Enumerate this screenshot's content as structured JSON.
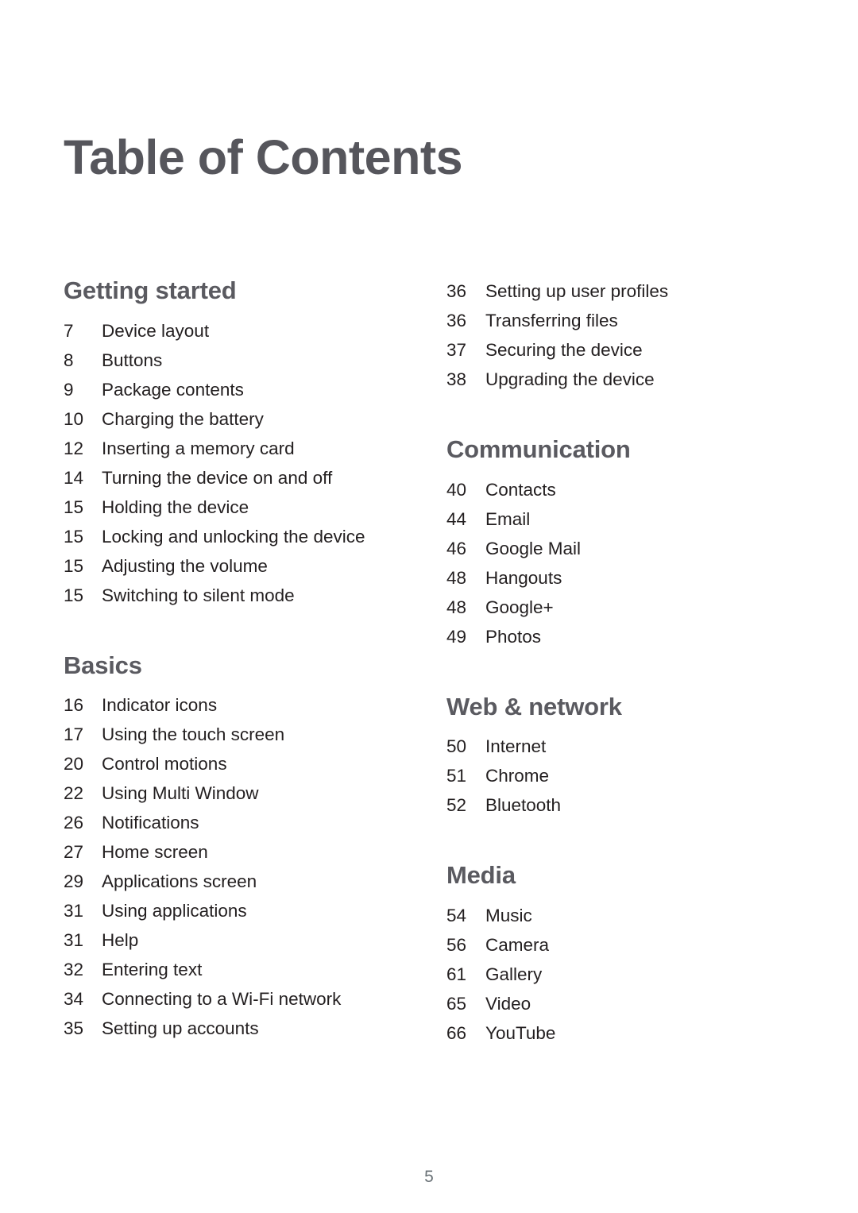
{
  "document": {
    "title": "Table of Contents",
    "folio": "5",
    "colors": {
      "heading": "#5a5a60",
      "title": "#56565c",
      "body": "#231f20",
      "folio": "#6a7277",
      "background": "#ffffff"
    }
  },
  "columns": {
    "left": [
      {
        "heading": "Getting started",
        "heading_visible": true,
        "entries": [
          {
            "page": "7",
            "label": "Device layout"
          },
          {
            "page": "8",
            "label": "Buttons"
          },
          {
            "page": "9",
            "label": "Package contents"
          },
          {
            "page": "10",
            "label": "Charging the battery"
          },
          {
            "page": "12",
            "label": "Inserting a memory card"
          },
          {
            "page": "14",
            "label": "Turning the device on and off"
          },
          {
            "page": "15",
            "label": "Holding the device"
          },
          {
            "page": "15",
            "label": "Locking and unlocking the device"
          },
          {
            "page": "15",
            "label": "Adjusting the volume"
          },
          {
            "page": "15",
            "label": "Switching to silent mode"
          }
        ]
      },
      {
        "heading": "Basics",
        "heading_visible": true,
        "entries": [
          {
            "page": "16",
            "label": "Indicator icons"
          },
          {
            "page": "17",
            "label": "Using the touch screen"
          },
          {
            "page": "20",
            "label": "Control motions"
          },
          {
            "page": "22",
            "label": "Using Multi Window"
          },
          {
            "page": "26",
            "label": "Notifications"
          },
          {
            "page": "27",
            "label": "Home screen"
          },
          {
            "page": "29",
            "label": "Applications screen"
          },
          {
            "page": "31",
            "label": "Using applications"
          },
          {
            "page": "31",
            "label": "Help"
          },
          {
            "page": "32",
            "label": "Entering text"
          },
          {
            "page": "34",
            "label": "Connecting to a Wi-Fi network"
          },
          {
            "page": "35",
            "label": "Setting up accounts"
          }
        ]
      }
    ],
    "right": [
      {
        "heading": "",
        "heading_visible": false,
        "entries": [
          {
            "page": "36",
            "label": "Setting up user profiles"
          },
          {
            "page": "36",
            "label": "Transferring files"
          },
          {
            "page": "37",
            "label": "Securing the device"
          },
          {
            "page": "38",
            "label": "Upgrading the device"
          }
        ]
      },
      {
        "heading": "Communication",
        "heading_visible": true,
        "entries": [
          {
            "page": "40",
            "label": "Contacts"
          },
          {
            "page": "44",
            "label": "Email"
          },
          {
            "page": "46",
            "label": "Google Mail"
          },
          {
            "page": "48",
            "label": "Hangouts"
          },
          {
            "page": "48",
            "label": "Google+"
          },
          {
            "page": "49",
            "label": "Photos"
          }
        ]
      },
      {
        "heading": "Web & network",
        "heading_visible": true,
        "entries": [
          {
            "page": "50",
            "label": "Internet"
          },
          {
            "page": "51",
            "label": "Chrome"
          },
          {
            "page": "52",
            "label": "Bluetooth"
          }
        ]
      },
      {
        "heading": "Media",
        "heading_visible": true,
        "entries": [
          {
            "page": "54",
            "label": "Music"
          },
          {
            "page": "56",
            "label": "Camera"
          },
          {
            "page": "61",
            "label": "Gallery"
          },
          {
            "page": "65",
            "label": "Video"
          },
          {
            "page": "66",
            "label": "YouTube"
          }
        ]
      }
    ]
  }
}
